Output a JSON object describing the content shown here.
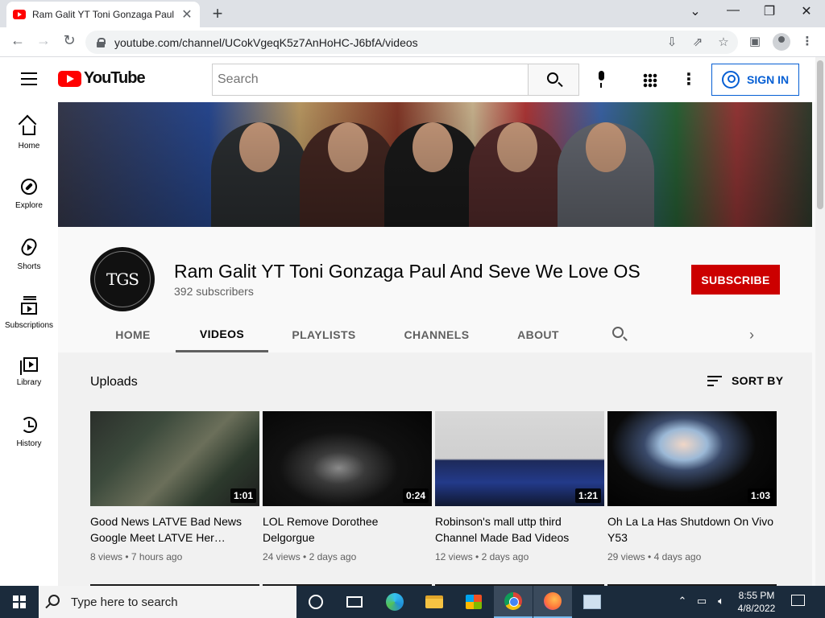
{
  "browser": {
    "tab_title": "Ram Galit YT Toni Gonzaga Paul And Seve We Love OS",
    "tab_close": "✕",
    "new_tab": "+",
    "minimize": "—",
    "restore": "❐",
    "close": "✕",
    "chevron": "⌄",
    "url": "youtube.com/channel/UCokVgeqK5z7AnHoHC-J6bfA/videos"
  },
  "header": {
    "logo_text": "YouTube",
    "search_placeholder": "Search",
    "signin_label": "SIGN IN"
  },
  "guide": [
    {
      "label": "Home"
    },
    {
      "label": "Explore"
    },
    {
      "label": "Shorts"
    },
    {
      "label": "Subscriptions"
    },
    {
      "label": "Library"
    },
    {
      "label": "History"
    }
  ],
  "channel": {
    "avatar_text": "TGS",
    "name": "Ram Galit YT Toni Gonzaga Paul And Seve We Love OS",
    "subscribers": "392 subscribers",
    "subscribe_label": "SUBSCRIBE",
    "tabs": [
      "HOME",
      "VIDEOS",
      "PLAYLISTS",
      "CHANNELS",
      "ABOUT"
    ],
    "active_tab": "VIDEOS"
  },
  "uploads": {
    "title": "Uploads",
    "sort_label": "SORT BY",
    "videos": [
      {
        "title": "Good News LATVE Bad News Google Meet LATVE Her…",
        "duration": "1:01",
        "views": "8 views",
        "age": "7 hours ago"
      },
      {
        "title": "LOL Remove Dorothee Delgorgue",
        "duration": "0:24",
        "views": "24 views",
        "age": "2 days ago"
      },
      {
        "title": "Robinson's mall uttp third Channel Made Bad Videos",
        "duration": "1:21",
        "views": "12 views",
        "age": "2 days ago"
      },
      {
        "title": "Oh La La Has Shutdown On Vivo Y53",
        "duration": "1:03",
        "views": "29 views",
        "age": "4 days ago"
      }
    ]
  },
  "taskbar": {
    "search_placeholder": "Type here to search",
    "time": "8:55 PM",
    "date": "4/8/2022"
  },
  "colors": {
    "youtube_red": "#ff0000",
    "subscribe_red": "#cc0000",
    "signin_blue": "#065fd4",
    "taskbar": "#1b2b3c"
  }
}
